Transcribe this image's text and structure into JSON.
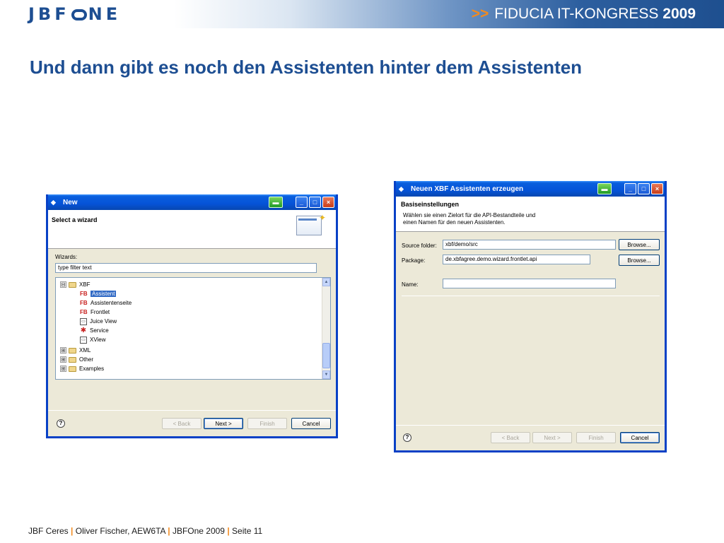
{
  "header": {
    "logo_left": "JBF",
    "logo_right": "NE",
    "arrows": ">>",
    "event_name": "FIDUCIA IT-KONGRESS",
    "event_year": "2009"
  },
  "slide_title": "Und dann gibt es noch den Assistenten hinter dem Assistenten",
  "dialog_new": {
    "title": "New",
    "banner_title": "Select a wizard",
    "wizards_label": "Wizards:",
    "filter_value": "type filter text",
    "tree": [
      {
        "label": "XBF",
        "expander": "⊟"
      },
      {
        "label": "Assistent"
      },
      {
        "label": "Assistentenseite"
      },
      {
        "label": "Frontlet"
      },
      {
        "label": "Juice View"
      },
      {
        "label": "Service"
      },
      {
        "label": "XView"
      },
      {
        "label": "XML",
        "expander": "⊞"
      },
      {
        "label": "Other",
        "expander": "⊞"
      },
      {
        "label": "Examples",
        "expander": "⊞"
      }
    ],
    "buttons": {
      "back": "< Back",
      "next": "Next >",
      "finish": "Finish",
      "cancel": "Cancel"
    }
  },
  "dialog_xbf": {
    "title": "Neuen XBF Assistenten erzeugen",
    "banner_title": "Basiseinstellungen",
    "banner_desc_1": "Wählen sie einen Zielort für die API-Bestandteile und",
    "banner_desc_2": "einen Namen für den neuen Assistenten.",
    "source_folder_label": "Source folder:",
    "source_folder_value": "xbf/demo/src",
    "package_label": "Package:",
    "package_value": "de.xbfagree.demo.wizard.frontlet.api",
    "name_label": "Name:",
    "name_value": "",
    "browse": "Browse...",
    "buttons": {
      "back": "< Back",
      "next": "Next >",
      "finish": "Finish",
      "cancel": "Cancel"
    }
  },
  "footer": {
    "part1": "JBF Ceres",
    "part2": "Oliver Fischer, AEW6TA",
    "part3": "JBFOne 2009",
    "part4": "Seite 11",
    "sep": "|"
  },
  "colors": {
    "brand_blue": "#1d4e92",
    "accent_orange": "#f28a1e",
    "xp_title_blue": "#0553d8"
  }
}
